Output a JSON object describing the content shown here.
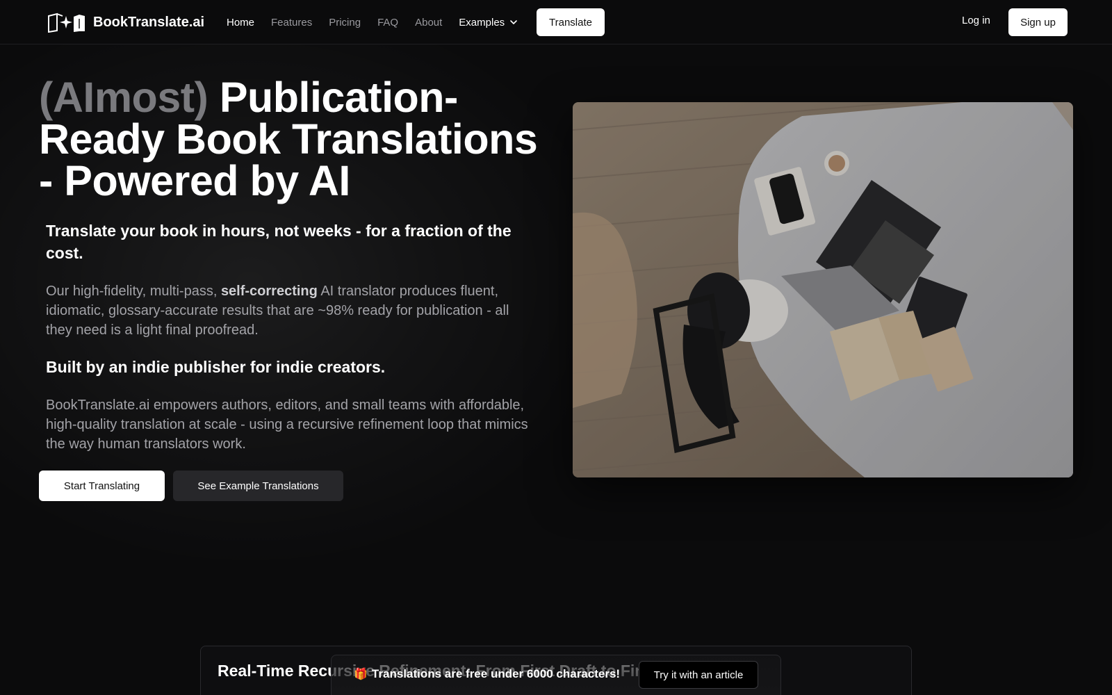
{
  "header": {
    "brand_name": "BookTranslate.ai",
    "nav": [
      {
        "label": "Home"
      },
      {
        "label": "Features"
      },
      {
        "label": "Pricing"
      },
      {
        "label": "FAQ"
      },
      {
        "label": "About"
      },
      {
        "label": "Examples"
      }
    ],
    "translate_label": "Translate",
    "login_label": "Log in",
    "signup_label": "Sign up"
  },
  "hero": {
    "title_muted": "(AImost)",
    "title_main": " Publication-Ready Book Translations - Powered by AI",
    "subtitle": "Translate your book in hours, not weeks - for a fraction of the cost.",
    "para1_prefix": "Our high-fidelity, multi-pass, ",
    "para1_bold": "self-correcting",
    "para1_suffix": " AI translator produces fluent, idiomatic, glossary-accurate results that are ~98% ready for publication - all they need is a light final proofread.",
    "subtitle2": "Built by an indie publisher for indie creators.",
    "para2": "BookTranslate.ai empowers authors, editors, and small teams with affordable, high-quality translation at scale - using a recursive refinement loop that mimics the way human translators work.",
    "cta_primary": "Start Translating",
    "cta_secondary": "See Example Translations"
  },
  "feature_card": {
    "title": "Real-Time Recursive Refinement: From First Draft to Final"
  },
  "promo": {
    "icon": "gift-icon",
    "text": "Translations are free under 6000 characters!",
    "button": "Try it with an article"
  },
  "colors": {
    "background": "#0b0b0c",
    "muted_title": "#7a7a7e",
    "body_text": "#a3a3a8",
    "button_primary": "#ffffff",
    "button_secondary": "#27272a"
  }
}
